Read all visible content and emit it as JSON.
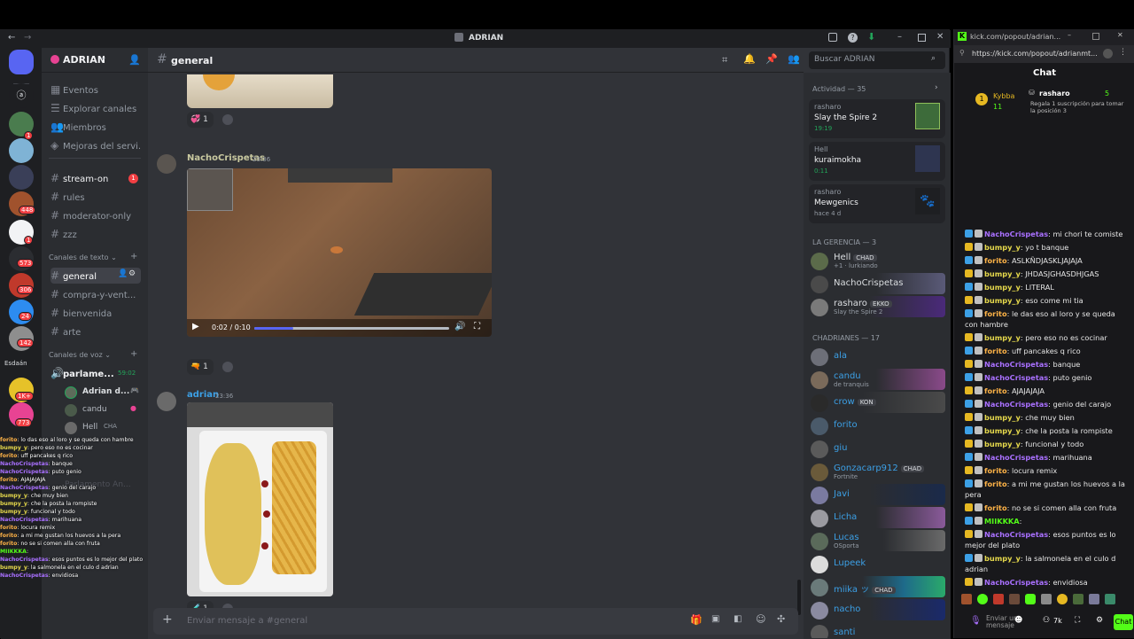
{
  "discord": {
    "window_title": "ADRIAN",
    "server_name": "ADRIAN",
    "server_label": "Esdaán",
    "server_badges": [
      "1",
      "448",
      "1",
      "573",
      "306",
      "24",
      "142",
      "1K+",
      "773"
    ],
    "nav_items": [
      "Eventos",
      "Explorar canales",
      "Miembros",
      "Mejoras del servi..."
    ],
    "top_channels": [
      {
        "name": "stream-on",
        "badge": "1"
      },
      {
        "name": "rules"
      },
      {
        "name": "moderator-only"
      },
      {
        "name": "zzz"
      }
    ],
    "text_category": "Canales de texto",
    "text_channels": [
      "general",
      "compra-y-vent...",
      "bienvenida",
      "arte"
    ],
    "voice_category": "Canales de voz",
    "voice_channel": {
      "name": "parlame...",
      "time": "59:02"
    },
    "voice_users": [
      "Adrian d...",
      "candu",
      "Hell"
    ],
    "voice_user_tag": "CHA",
    "voice_faded_label": "Parlamento An...",
    "channel_header": "general",
    "search_placeholder": "Buscar ADRIAN",
    "messages": [
      {
        "author": "NachoCrispetas",
        "time": "23:36",
        "video_time": "0:02 / 0:10",
        "reaction_count": "1"
      },
      {
        "author": "adrian",
        "time": "23:36",
        "reaction_count": "1"
      }
    ],
    "top_reaction_count": "1",
    "composer_placeholder": "Enviar mensaje a #general",
    "activity": {
      "header": "Actividad — 35",
      "cards": [
        {
          "user": "rasharo",
          "title": "Slay the Spire 2",
          "time": "19:19"
        },
        {
          "user": "Hell",
          "title": "kuraimokha",
          "time": "0:11"
        },
        {
          "user": "rasharo",
          "title": "Mewgenics",
          "time": "hace 4 d"
        }
      ]
    },
    "gerencia": {
      "header": "LA GERENCIA — 3",
      "members": [
        {
          "name": "Hell",
          "tag": "CHAD",
          "sub": "+1 · lurkiando"
        },
        {
          "name": "NachoCrispetas"
        },
        {
          "name": "rasharo",
          "tag": "EKKO",
          "sub": "Slay the Spire 2"
        }
      ]
    },
    "chadrianes": {
      "header": "CHADRIANES — 17",
      "members": [
        {
          "name": "ala"
        },
        {
          "name": "candu",
          "sub": "de tranquis"
        },
        {
          "name": "crow",
          "tag": "KON"
        },
        {
          "name": "forito"
        },
        {
          "name": "giu"
        },
        {
          "name": "Gonzacarp912",
          "tag": "CHAD",
          "sub": "Fortnite"
        },
        {
          "name": "Javi"
        },
        {
          "name": "Licha"
        },
        {
          "name": "Lucas",
          "sub": "OSporta"
        },
        {
          "name": "Lupeek"
        },
        {
          "name": "miika ッ",
          "tag": "CHAD"
        },
        {
          "name": "nacho"
        },
        {
          "name": "santi"
        }
      ]
    }
  },
  "overlay_chat": [
    {
      "user": "forito",
      "text": ": lo das eso al loro y se queda con hambre"
    },
    {
      "user": "bumpy_y",
      "text": ": pero eso no es cocinar"
    },
    {
      "user": "forito",
      "text": ": uff pancakes q rico"
    },
    {
      "user": "NachoCrispetas",
      "text": ": banque"
    },
    {
      "user": "NachoCrispetas",
      "text": ": puto genio"
    },
    {
      "user": "forito",
      "text": ": AJAJAJAJA"
    },
    {
      "user": "NachoCrispetas",
      "text": ": genio del carajo"
    },
    {
      "user": "bumpy_y",
      "text": ": che muy bien"
    },
    {
      "user": "bumpy_y",
      "text": ": che la posta la rompiste"
    },
    {
      "user": "bumpy_y",
      "text": ": funcional y todo"
    },
    {
      "user": "NachoCrispetas",
      "text": ": marihuana"
    },
    {
      "user": "forito",
      "text": ": locura remix"
    },
    {
      "user": "forito",
      "text": ": a mi me gustan los huevos a la pera"
    },
    {
      "user": "forito",
      "text": ": no se si comen alla con fruta"
    },
    {
      "user": "MIIKKKA",
      "text": ":"
    },
    {
      "user": "NachoCrispetas",
      "text": ": esos puntos es lo mejor del plato"
    },
    {
      "user": "bumpy_y",
      "text": ": la salmonela en el culo d adrian"
    },
    {
      "user": "NachoCrispetas",
      "text": ": envidiosa"
    }
  ],
  "kick": {
    "url_short": "kick.com/popout/adrian...",
    "url_full": "https://kick.com/popout/adrianmt...",
    "chat_title": "Chat",
    "leaderboard": {
      "first": "Kybba",
      "first_count": "11",
      "second": "rasharo",
      "second_count": "5",
      "promo": "Regala 1 suscripción para tomar la posición 3"
    },
    "messages": [
      {
        "user": "NachoCrispetas",
        "text": ": mi chori te comiste",
        "color": "#a970ff"
      },
      {
        "user": "bumpy_y",
        "text": ": yo t banque",
        "color": "#e6d94c"
      },
      {
        "user": "forito",
        "text": ": ASLKÑDJASKLJAJAJA",
        "color": "#ffb347"
      },
      {
        "user": "bumpy_y",
        "text": ": JHDASJGHASDHJGAS",
        "color": "#e6d94c"
      },
      {
        "user": "bumpy_y",
        "text": ": LITERAL",
        "color": "#e6d94c"
      },
      {
        "user": "bumpy_y",
        "text": ": eso come mi tia",
        "color": "#e6d94c"
      },
      {
        "user": "forito",
        "text": ": le das eso al loro y se queda con hambre",
        "color": "#ffb347"
      },
      {
        "user": "bumpy_y",
        "text": ": pero eso no es cocinar",
        "color": "#e6d94c"
      },
      {
        "user": "forito",
        "text": ": uff pancakes q rico",
        "color": "#ffb347"
      },
      {
        "user": "NachoCrispetas",
        "text": ": banque",
        "color": "#a970ff"
      },
      {
        "user": "NachoCrispetas",
        "text": ": puto genio",
        "color": "#a970ff"
      },
      {
        "user": "forito",
        "text": ": AJAJAJAJA",
        "color": "#ffb347"
      },
      {
        "user": "NachoCrispetas",
        "text": ": genio del carajo",
        "color": "#a970ff"
      },
      {
        "user": "bumpy_y",
        "text": ": che muy bien",
        "color": "#e6d94c"
      },
      {
        "user": "bumpy_y",
        "text": ": che la posta la rompiste",
        "color": "#e6d94c"
      },
      {
        "user": "bumpy_y",
        "text": ": funcional y todo",
        "color": "#e6d94c"
      },
      {
        "user": "NachoCrispetas",
        "text": ": marihuana",
        "color": "#a970ff"
      },
      {
        "user": "forito",
        "text": ": locura remix",
        "color": "#ffb347"
      },
      {
        "user": "forito",
        "text": ": a mi me gustan los huevos a la pera",
        "color": "#ffb347"
      },
      {
        "user": "forito",
        "text": ": no se si comen alla con fruta",
        "color": "#ffb347"
      },
      {
        "user": "MIIKKKA",
        "text": ":",
        "color": "#53fc18"
      },
      {
        "user": "NachoCrispetas",
        "text": ": esos puntos es lo mejor del plato",
        "color": "#a970ff"
      },
      {
        "user": "bumpy_y",
        "text": ": la salmonela en el culo d adrian",
        "color": "#e6d94c"
      },
      {
        "user": "NachoCrispetas",
        "text": ": envidiosa",
        "color": "#a970ff"
      }
    ],
    "send_placeholder": "Enviar un mensaje",
    "send_button": "Chat",
    "points": "7k",
    "brand_color": "#53fc18"
  }
}
